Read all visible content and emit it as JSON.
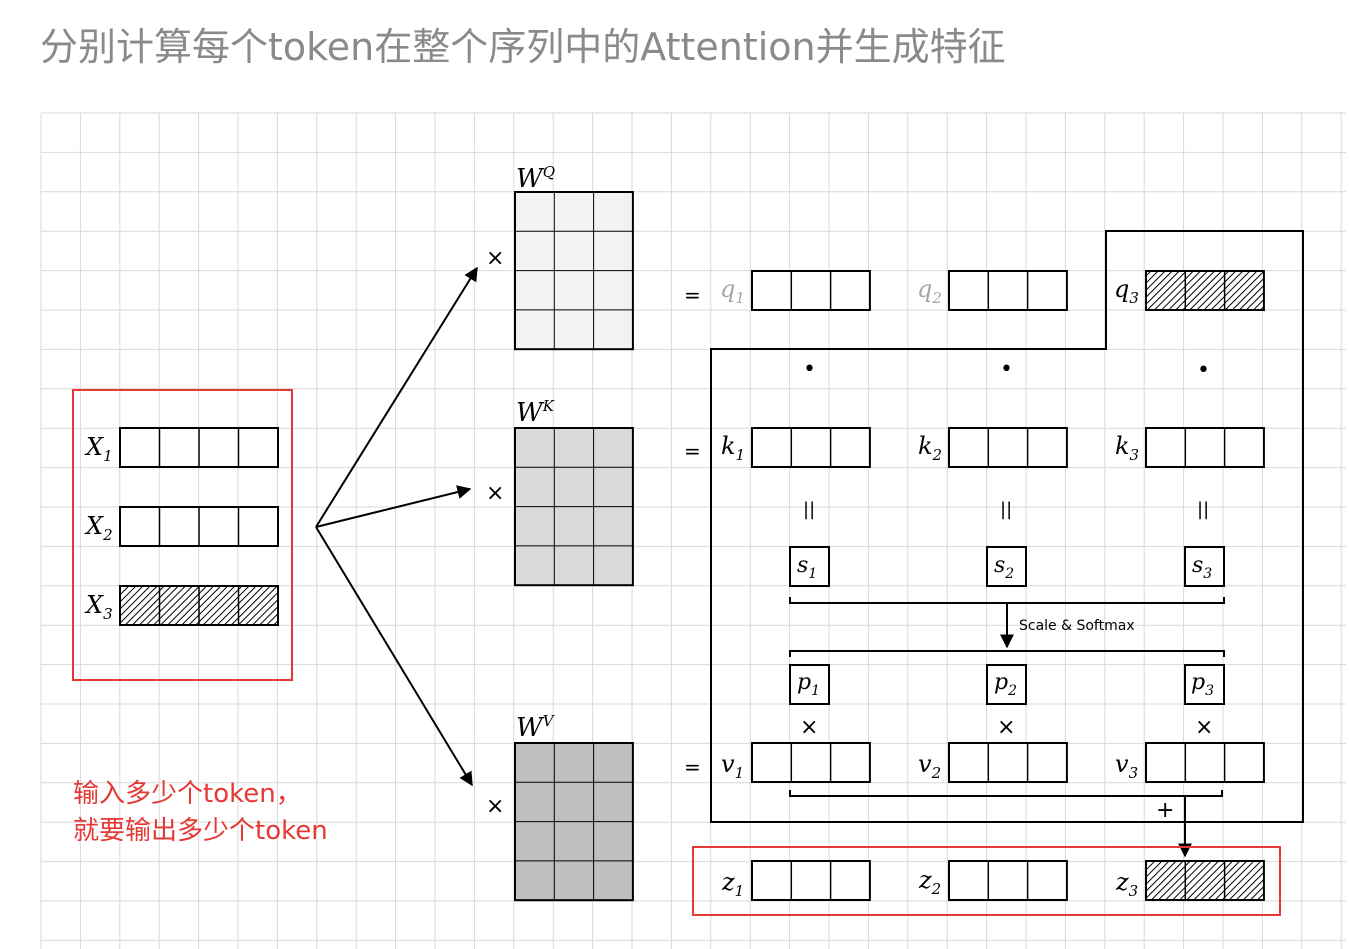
{
  "title": "分别计算每个token在整个序列中的Attention并生成特征",
  "colors": {
    "grid": "#d9d9d9",
    "highlight": "#e53935",
    "wq_fill": "#f2f2f2",
    "wk_fill": "#d9d9d9",
    "wv_fill": "#bfbfbf",
    "faded_label": "#a6a6a6",
    "ink": "#000000"
  },
  "inputs": {
    "labels": [
      {
        "base": "X",
        "sub": "1"
      },
      {
        "base": "X",
        "sub": "2"
      },
      {
        "base": "X",
        "sub": "3"
      }
    ]
  },
  "weights": [
    {
      "base": "W",
      "sup": "Q",
      "mult": "×"
    },
    {
      "base": "W",
      "sup": "K",
      "mult": "×"
    },
    {
      "base": "W",
      "sup": "V",
      "mult": "×"
    }
  ],
  "rows": {
    "q": {
      "eq": "=",
      "labels": [
        {
          "base": "q",
          "sub": "1"
        },
        {
          "base": "q",
          "sub": "2"
        },
        {
          "base": "q",
          "sub": "3"
        }
      ]
    },
    "dot": "•",
    "k": {
      "eq": "=",
      "labels": [
        {
          "base": "k",
          "sub": "1"
        },
        {
          "base": "k",
          "sub": "2"
        },
        {
          "base": "k",
          "sub": "3"
        }
      ]
    },
    "equals_vertical": "||",
    "s": {
      "labels": [
        {
          "base": "s",
          "sub": "1"
        },
        {
          "base": "s",
          "sub": "2"
        },
        {
          "base": "s",
          "sub": "3"
        }
      ]
    },
    "softmax_label": "Scale & Softmax",
    "p": {
      "labels": [
        {
          "base": "p",
          "sub": "1"
        },
        {
          "base": "p",
          "sub": "2"
        },
        {
          "base": "p",
          "sub": "3"
        }
      ]
    },
    "times": "×",
    "v": {
      "eq": "=",
      "labels": [
        {
          "base": "v",
          "sub": "1"
        },
        {
          "base": "v",
          "sub": "2"
        },
        {
          "base": "v",
          "sub": "3"
        }
      ]
    },
    "plus": "+",
    "z": {
      "labels": [
        {
          "base": "z",
          "sub": "1"
        },
        {
          "base": "z",
          "sub": "2"
        },
        {
          "base": "z",
          "sub": "3"
        }
      ]
    }
  },
  "note": {
    "line1": "输入多少个token，",
    "line2": "就要输出多少个token"
  }
}
